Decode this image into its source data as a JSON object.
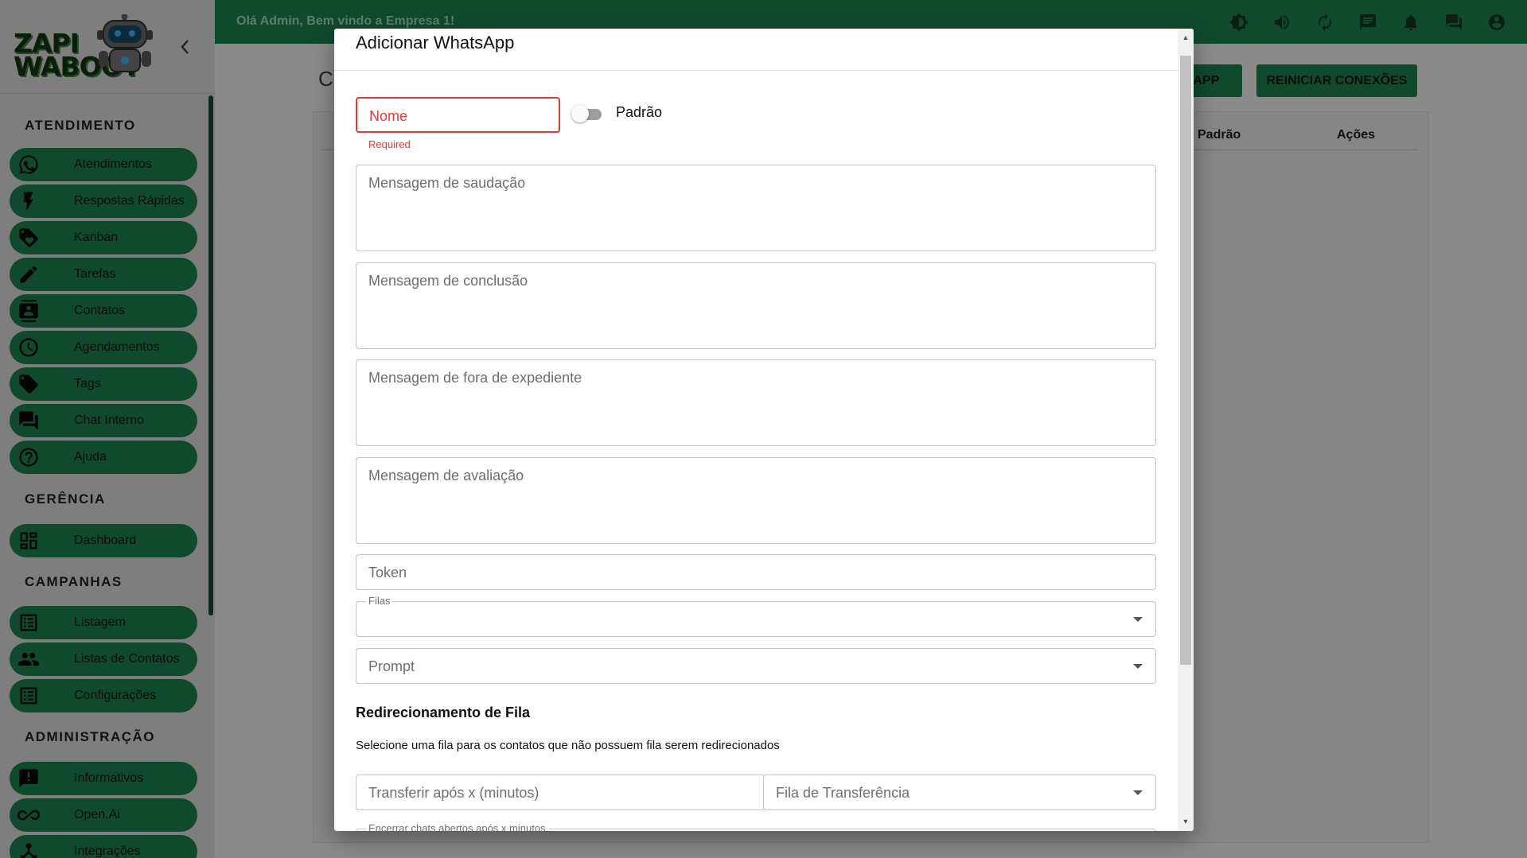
{
  "app": {
    "welcome": "Olá Admin, Bem vindo a Empresa 1!",
    "logo_line1": "ZAPI",
    "logo_line2": "WABOOT"
  },
  "sidebar": {
    "sections": {
      "atendimento": "ATENDIMENTO",
      "gerencia": "GERÊNCIA",
      "campanhas": "CAMPANHAS",
      "administracao": "ADMINISTRAÇÃO"
    },
    "items": [
      {
        "label": "Atendimentos",
        "icon": "whatsapp-icon"
      },
      {
        "label": "Respostas Rápidas",
        "icon": "lightning-icon"
      },
      {
        "label": "Kanban",
        "icon": "tag-heart-icon"
      },
      {
        "label": "Tarefas",
        "icon": "pencil-icon"
      },
      {
        "label": "Contatos",
        "icon": "contact-card-icon"
      },
      {
        "label": "Agendamentos",
        "icon": "clock-icon"
      },
      {
        "label": "Tags",
        "icon": "tag-icon"
      },
      {
        "label": "Chat Interno",
        "icon": "chat-icon"
      },
      {
        "label": "Ajuda",
        "icon": "help-icon"
      },
      {
        "label": "Dashboard",
        "icon": "dashboard-icon"
      },
      {
        "label": "Listagem",
        "icon": "list-icon"
      },
      {
        "label": "Listas de Contatos",
        "icon": "people-icon"
      },
      {
        "label": "Configurações",
        "icon": "list-settings-icon"
      },
      {
        "label": "Informativos",
        "icon": "announcement-icon"
      },
      {
        "label": "Open.Ai",
        "icon": "infinity-icon"
      },
      {
        "label": "Integrações",
        "icon": "integration-icon"
      }
    ]
  },
  "topbar": {
    "icons": [
      "brightness-icon",
      "volume-icon",
      "refresh-icon",
      "message-icon",
      "bell-icon",
      "forum-icon",
      "account-icon"
    ]
  },
  "background": {
    "page_title": "C",
    "btn_add": "SAPP",
    "btn_restart": "REINICIAR CONEXÕES",
    "col_default": "Padrão",
    "col_actions": "Ações"
  },
  "modal": {
    "title": "Adicionar WhatsApp",
    "name_placeholder": "Nome",
    "name_error": "Required",
    "default_toggle_label": "Padrão",
    "greeting_placeholder": "Mensagem de saudação",
    "completion_placeholder": "Mensagem de conclusão",
    "out_of_hours_placeholder": "Mensagem de fora de expediente",
    "rating_placeholder": "Mensagem de avaliação",
    "token_placeholder": "Token",
    "queues_label": "Filas",
    "prompt_placeholder": "Prompt",
    "redirect_heading": "Redirecionamento de Fila",
    "redirect_desc": "Selecione uma fila para os contatos que não possuem fila serem redirecionados",
    "transfer_after_placeholder": "Transferir após x (minutos)",
    "transfer_queue_placeholder": "Fila de Transferência",
    "close_chats_label": "Encerrar chats abertos após x minutos"
  }
}
